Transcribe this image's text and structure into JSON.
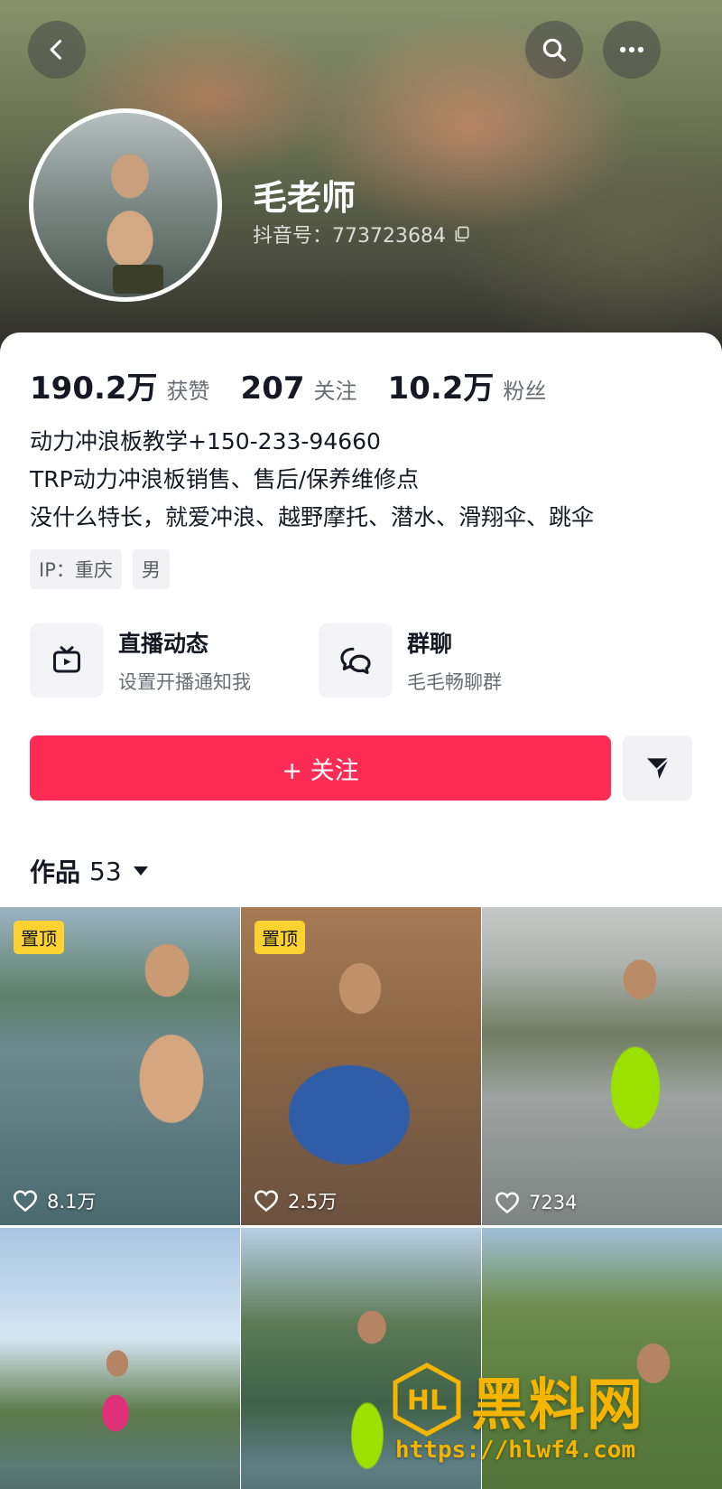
{
  "header": {
    "nickname": "毛老师",
    "douyin_id": "抖音号：773723684"
  },
  "stats": [
    {
      "value": "190.2万",
      "label": "获赞"
    },
    {
      "value": "207",
      "label": "关注"
    },
    {
      "value": "10.2万",
      "label": "粉丝"
    }
  ],
  "bio": [
    "动力冲浪板教学+150-233-94660",
    "TRP动力冲浪板销售、售后/保养维修点",
    "没什么特长，就爱冲浪、越野摩托、潜水、滑翔伞、跳伞"
  ],
  "tags": [
    "IP：重庆",
    "男"
  ],
  "features": {
    "live": {
      "title": "直播动态",
      "subtitle": "设置开播通知我",
      "icon": "tv-icon"
    },
    "group": {
      "title": "群聊",
      "subtitle": "毛毛畅聊群",
      "icon": "chat-bubbles-icon"
    }
  },
  "actions": {
    "follow_label": "+ 关注",
    "share_icon": "send-icon"
  },
  "works": {
    "label": "作品",
    "count": "53"
  },
  "videos": [
    {
      "pinned_label": "置顶",
      "likes": "8.1万"
    },
    {
      "pinned_label": "置顶",
      "likes": "2.5万"
    },
    {
      "pinned_label": "",
      "likes": "7234"
    },
    {
      "pinned_label": "",
      "likes": ""
    },
    {
      "pinned_label": "",
      "likes": ""
    },
    {
      "pinned_label": "",
      "likes": ""
    }
  ],
  "watermark": {
    "brand": "黑料网",
    "logo_text": "HL",
    "url": "https://hlwf4.com"
  },
  "colors": {
    "follow": "#fe2c55",
    "pin": "#fcd232",
    "watermark": "#f5b400"
  }
}
